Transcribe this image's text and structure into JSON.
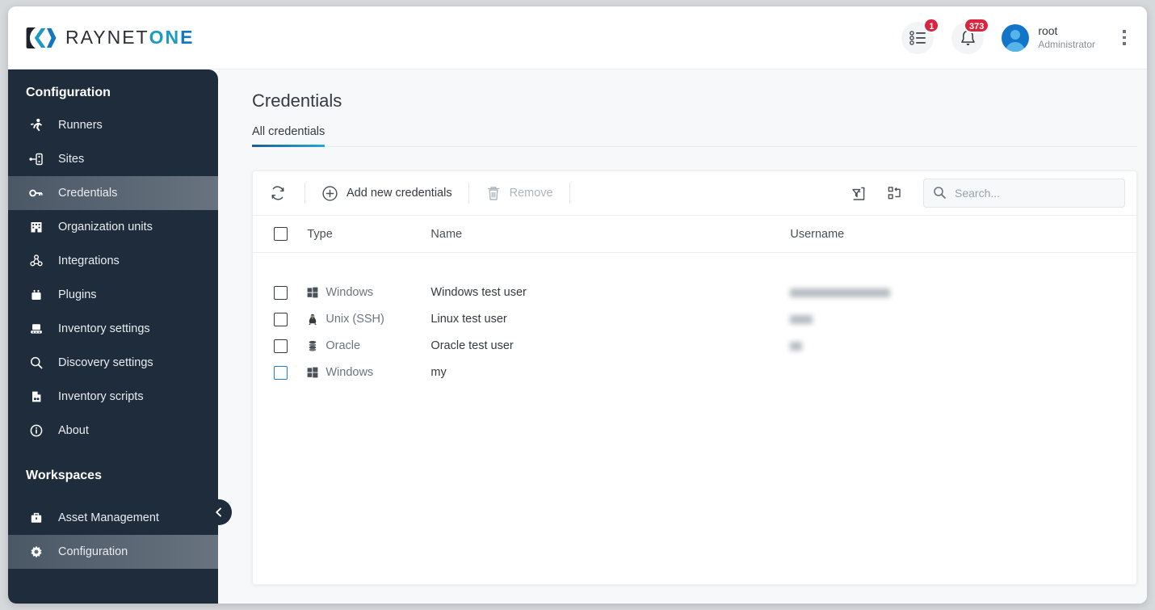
{
  "brand": {
    "mark_icon": "raynet-logo-icon",
    "text_part1": "RAYNET",
    "text_part2": "ON",
    "text_part3": "E",
    "color_dark": "#2b3036",
    "color_teal": "#1b9bc4",
    "color_blue": "#1277bf"
  },
  "header": {
    "tasks": {
      "icon": "task-list-icon",
      "badge": "1"
    },
    "notifications": {
      "icon": "bell-icon",
      "badge": "373"
    },
    "user": {
      "name": "root",
      "role": "Administrator",
      "avatar_icon": "user-avatar-icon"
    },
    "overflow_icon": "kebab-menu-icon",
    "badge_color": "#d9253f"
  },
  "sidebar": {
    "section_configuration": "Configuration",
    "section_workspaces": "Workspaces",
    "collapse_icon": "chevron-left-icon",
    "background_color": "#1e2c3c",
    "config_items": [
      {
        "label": "Runners",
        "icon": "runner-icon",
        "active": false
      },
      {
        "label": "Sites",
        "icon": "sitemap-icon",
        "active": false
      },
      {
        "label": "Credentials",
        "icon": "key-icon",
        "active": true
      },
      {
        "label": "Organization units",
        "icon": "building-icon",
        "active": false
      },
      {
        "label": "Integrations",
        "icon": "integrations-icon",
        "active": false
      },
      {
        "label": "Plugins",
        "icon": "plug-icon",
        "active": false
      },
      {
        "label": "Inventory settings",
        "icon": "inventory-icon",
        "active": false
      },
      {
        "label": "Discovery settings",
        "icon": "search-icon",
        "active": false
      },
      {
        "label": "Inventory scripts",
        "icon": "script-file-icon",
        "active": false
      },
      {
        "label": "About",
        "icon": "info-circle-icon",
        "active": false
      }
    ],
    "workspace_items": [
      {
        "label": "Asset Management",
        "icon": "briefcase-icon",
        "active": false
      },
      {
        "label": "Configuration",
        "icon": "gear-icon",
        "active": true
      }
    ]
  },
  "main": {
    "page_title": "Credentials",
    "tabs": [
      {
        "label": "All credentials",
        "active": true
      }
    ],
    "tab_underline_color": "#22a7dd"
  },
  "toolbar": {
    "refresh": {
      "label": "",
      "icon": "refresh-icon"
    },
    "add": {
      "label": "Add new credentials",
      "icon": "plus-circle-icon"
    },
    "remove": {
      "label": "Remove",
      "icon": "trash-icon",
      "disabled": true
    },
    "filter_reset": {
      "icon": "filter-reset-icon"
    },
    "column_config": {
      "icon": "column-config-icon"
    },
    "search": {
      "placeholder": "Search...",
      "value": "",
      "icon": "search-icon"
    }
  },
  "table": {
    "select_all_checked": false,
    "columns": [
      "Type",
      "Name",
      "Username"
    ],
    "rows": [
      {
        "type": "Windows",
        "type_icon": "windows-icon",
        "name": "Windows test user",
        "username_redacted": true,
        "username_width": 124,
        "checkbox_focused": false
      },
      {
        "type": "Unix (SSH)",
        "type_icon": "linux-icon",
        "name": "Linux test user",
        "username_redacted": true,
        "username_width": 28,
        "checkbox_focused": false
      },
      {
        "type": "Oracle",
        "type_icon": "oracle-icon",
        "name": "Oracle test user",
        "username_redacted": true,
        "username_width": 15,
        "checkbox_focused": false
      },
      {
        "type": "Windows",
        "type_icon": "windows-icon",
        "name": "my",
        "username_redacted": false,
        "username_width": 0,
        "checkbox_focused": true
      }
    ]
  }
}
